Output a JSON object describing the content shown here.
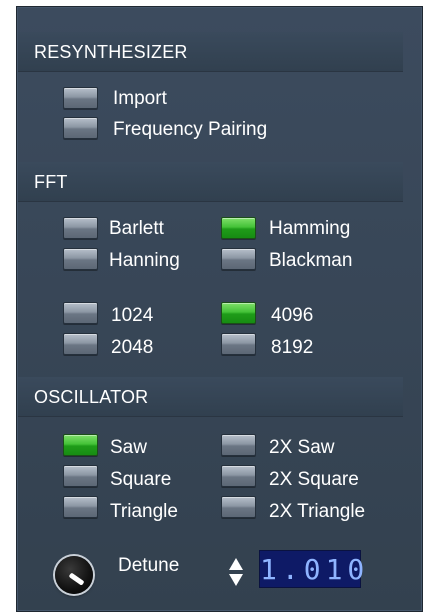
{
  "sections": {
    "resynthesizer": {
      "title": "RESYNTHESIZER",
      "buttons": [
        {
          "label": "Import",
          "on": false
        },
        {
          "label": "Frequency Pairing",
          "on": false
        }
      ]
    },
    "fft": {
      "title": "FFT",
      "windows": [
        {
          "label": "Barlett",
          "on": false
        },
        {
          "label": "Hamming",
          "on": true
        },
        {
          "label": "Hanning",
          "on": false
        },
        {
          "label": "Blackman",
          "on": false
        }
      ],
      "sizes": [
        {
          "label": "1024",
          "on": false
        },
        {
          "label": "4096",
          "on": true
        },
        {
          "label": "2048",
          "on": false
        },
        {
          "label": "8192",
          "on": false
        }
      ]
    },
    "oscillator": {
      "title": "OSCILLATOR",
      "waves": [
        {
          "label": "Saw",
          "on": true
        },
        {
          "label": "2X Saw",
          "on": false
        },
        {
          "label": "Square",
          "on": false
        },
        {
          "label": "2X Square",
          "on": false
        },
        {
          "label": "Triangle",
          "on": false
        },
        {
          "label": "2X Triangle",
          "on": false
        }
      ],
      "detune_label": "Detune",
      "detune_value": "1.010"
    }
  },
  "colors": {
    "panel_bg": "#3a4859",
    "led_on": "#44c238",
    "led_off": "#8c97a4",
    "lcd_bg": "#0e1a66",
    "lcd_text": "#8fb4ff"
  }
}
